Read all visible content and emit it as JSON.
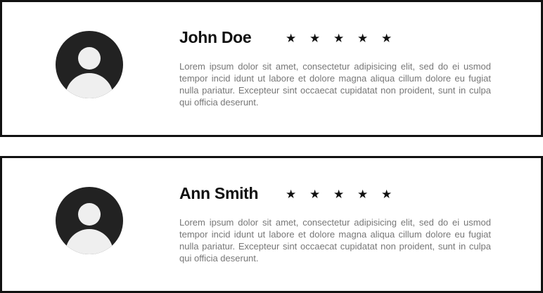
{
  "reviews": [
    {
      "name": "John Doe",
      "rating": 5,
      "text": "Lorem ipsum dolor sit amet, consectetur adipisicing elit, sed do ei usmod tempor incid idunt ut labore et dolore magna aliqua cillum dolore eu fugiat nulla pariatur. Excepteur sint occaecat cupidatat non proident, sunt in culpa qui officia deserunt."
    },
    {
      "name": "Ann Smith",
      "rating": 5,
      "text": "Lorem ipsum dolor sit amet, consectetur adipisicing elit, sed do ei usmod tempor incid idunt ut labore et dolore magna aliqua cillum dolore eu fugiat nulla pariatur. Excepteur sint occaecat cupidatat non proident, sunt in culpa qui officia deserunt."
    }
  ],
  "icons": {
    "avatar": "user-avatar-icon",
    "star": "star-icon"
  },
  "colors": {
    "border": "#111111",
    "avatar_bg": "#222222",
    "avatar_fg": "#efefef",
    "text_muted": "#777777"
  }
}
